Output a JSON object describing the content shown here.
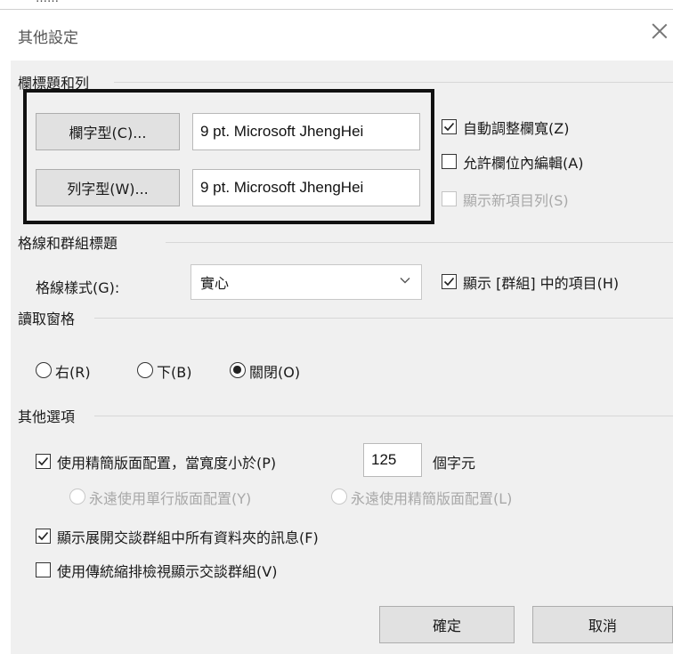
{
  "dialog": {
    "title": "其他設定",
    "top_fragment": "……"
  },
  "column_headings_rows": {
    "section_label": "欄標題和列",
    "column_font_button": "欄字型(C)...",
    "column_font_value": "9 pt. Microsoft JhengHei",
    "row_font_button": "列字型(W)...",
    "row_font_value": "9 pt. Microsoft JhengHei",
    "auto_column_width": {
      "label": "自動調整欄寬(Z)",
      "checked": true
    },
    "allow_in_cell_edit": {
      "label": "允許欄位內編輯(A)",
      "checked": false
    },
    "show_new_item_row": {
      "label": "顯示新項目列(S)",
      "checked": false,
      "disabled": true
    }
  },
  "grid_lines": {
    "section_label": "格線和群組標題",
    "style_label": "格線樣式(G):",
    "style_value": "實心",
    "show_in_group": {
      "label": "顯示 [群組] 中的項目(H)",
      "checked": true
    }
  },
  "reading_pane": {
    "section_label": "讀取窗格",
    "options": [
      {
        "label": "右(R)",
        "selected": false
      },
      {
        "label": "下(B)",
        "selected": false
      },
      {
        "label": "關閉(O)",
        "selected": true
      }
    ]
  },
  "other_options": {
    "section_label": "其他選項",
    "compact_layout": {
      "label": "使用精簡版面配置，當寬度小於(P)",
      "checked": true,
      "width_value": "125",
      "unit": "個字元"
    },
    "always_single_line": {
      "label": "永遠使用單行版面配置(Y)",
      "disabled": true
    },
    "always_compact": {
      "label": "永遠使用精簡版面配置(L)",
      "disabled": true
    },
    "show_all_folders": {
      "label": "顯示展開交談群組中所有資料夾的訊息(F)",
      "checked": true
    },
    "classic_indent": {
      "label": "使用傳統縮排檢視顯示交談群組(V)",
      "checked": false
    }
  },
  "footer": {
    "ok_label": "確定",
    "cancel_label": "取消"
  }
}
